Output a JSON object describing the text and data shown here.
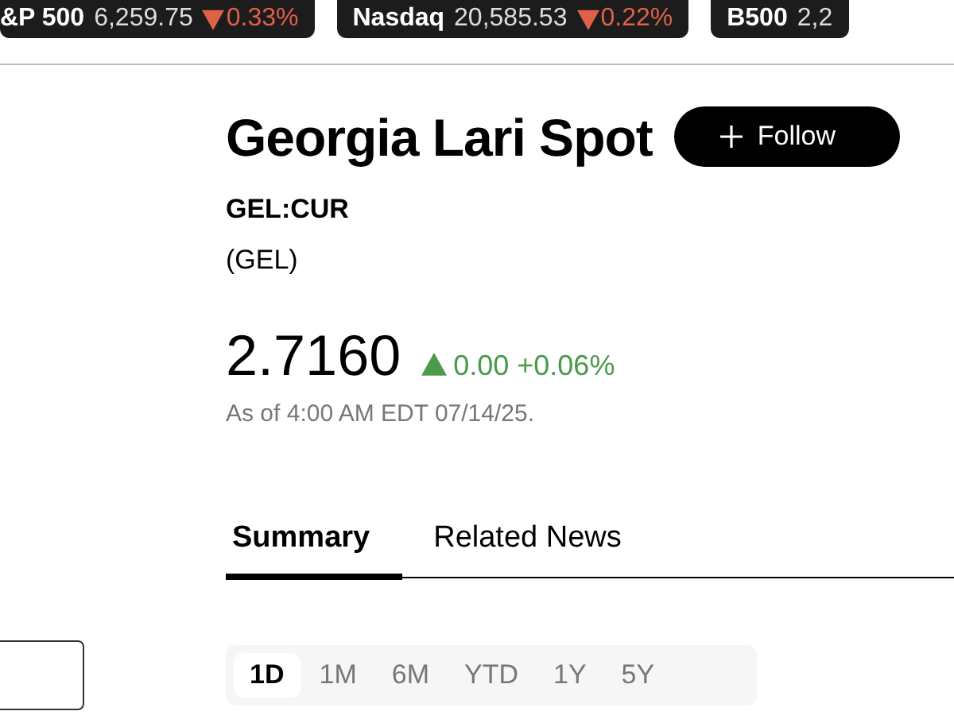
{
  "tickers": [
    {
      "name": "&P 500",
      "value": "6,259.75",
      "negative": true,
      "change": "0.33%"
    },
    {
      "name": "Nasdaq",
      "value": "20,585.53",
      "negative": true,
      "change": "0.22%"
    },
    {
      "name": "B500",
      "value": "2,2"
    }
  ],
  "quote": {
    "title": "Georgia Lari Spot",
    "follow": "Follow",
    "ticker": "GEL:CUR",
    "currency": "(GEL)",
    "price": "2.7160",
    "negative": false,
    "change": "0.00 +0.06%",
    "as_of": "As of 4:00 AM EDT 07/14/25."
  },
  "tabs": [
    {
      "label": "Summary",
      "selected": true
    },
    {
      "label": "Related News",
      "selected": false
    }
  ],
  "ranges": [
    {
      "label": "1D",
      "selected": true
    },
    {
      "label": "1M",
      "selected": false
    },
    {
      "label": "6M",
      "selected": false
    },
    {
      "label": "YTD",
      "selected": false
    },
    {
      "label": "1Y",
      "selected": false
    },
    {
      "label": "5Y",
      "selected": false
    }
  ]
}
